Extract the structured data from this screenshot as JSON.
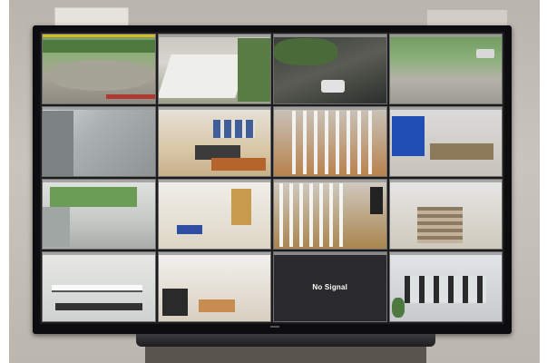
{
  "scene": {
    "description_free": true,
    "grid": {
      "rows": 4,
      "cols": 4
    }
  },
  "cameras": [
    {
      "active": true
    },
    {
      "active": false
    },
    {
      "active": false
    },
    {
      "active": false
    },
    {
      "active": false
    },
    {
      "active": false
    },
    {
      "active": false
    },
    {
      "active": false
    },
    {
      "active": false
    },
    {
      "active": false
    },
    {
      "active": false
    },
    {
      "active": false
    },
    {
      "active": false
    },
    {
      "active": false
    },
    {
      "active": false,
      "signal": false,
      "label": "No Signal"
    },
    {
      "active": false
    }
  ],
  "colors": {
    "active_tile_bar": "#e4c21c",
    "tile_bar": "#9a9a9a",
    "monitor_bezel": "#0d0d0f"
  }
}
